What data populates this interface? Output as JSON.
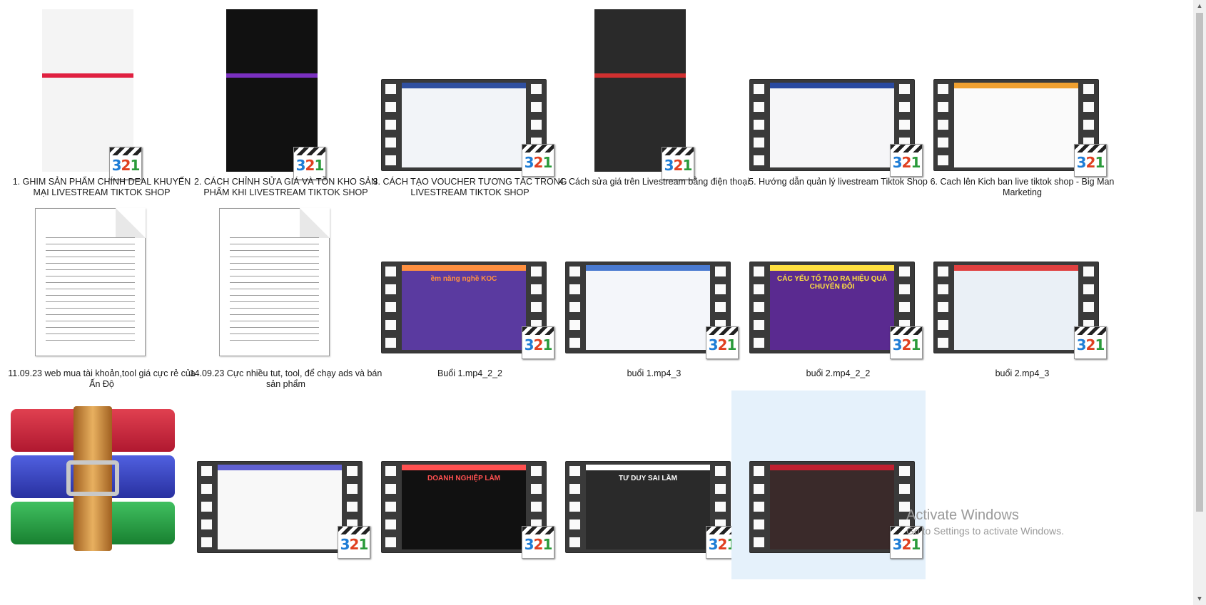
{
  "items": [
    {
      "kind": "video-portrait",
      "label": "1. GHIM SẢN PHẨM CHÍNH DEAL KHUYẾN MẠI LIVESTREAM TIKTOK SHOP",
      "screen": "#f4f4f4",
      "accent": "#e02040"
    },
    {
      "kind": "video-portrait",
      "label": "2. CÁCH CHỈNH SỬA GIÁ VÀ TỒN KHO SẢN PHẨM KHI LIVESTREAM TIKTOK SHOP",
      "screen": "#111111",
      "accent": "#7a30c0"
    },
    {
      "kind": "video",
      "label": "3. CÁCH TẠO VOUCHER TƯƠNG TÁC TRONG LIVESTREAM TIKTOK SHOP",
      "screen": "#f2f4f8",
      "accent": "#3050a0"
    },
    {
      "kind": "video-portrait",
      "label": "4. Cách sửa giá trên Livestream bằng điện thoại",
      "screen": "#2a2a2a",
      "accent": "#d03030"
    },
    {
      "kind": "video",
      "label": "5. Hướng dẫn quản lý livestream Tiktok Shop",
      "screen": "#f6f6f8",
      "accent": "#2a4aa0"
    },
    {
      "kind": "video",
      "label": "6. Cach lên Kich ban live tiktok shop - Big Man Marketing",
      "screen": "#fafafa",
      "accent": "#f0a030"
    },
    {
      "kind": "doc",
      "label": "11.09.23 web mua tài khoản,tool giá cực rẻ của Ấn Độ"
    },
    {
      "kind": "doc",
      "label": "14.09.23 Cực nhiều tut, tool, để chạy ads và bán sản phẩm"
    },
    {
      "kind": "video",
      "label": "Buổi 1.mp4_2_2",
      "screen": "#5a3aa0",
      "accent": "#ff9040",
      "caption": "ềm năng nghề KOC"
    },
    {
      "kind": "video",
      "label": "buổi 1.mp4_3",
      "screen": "#f4f6fa",
      "accent": "#4a7ad0"
    },
    {
      "kind": "video",
      "label": "buổi 2.mp4_2_2",
      "screen": "#5a2a90",
      "accent": "#ffe040",
      "caption": "CÁC YẾU TỐ TẠO RA HIỆU QUẢ CHUYỂN ĐỔI"
    },
    {
      "kind": "video",
      "label": "buổi 2.mp4_3",
      "screen": "#eaf0f6",
      "accent": "#e04040"
    },
    {
      "kind": "rar",
      "label": ""
    },
    {
      "kind": "video",
      "label": "",
      "screen": "#f8f8f8",
      "accent": "#6060d0"
    },
    {
      "kind": "video",
      "label": "",
      "screen": "#111111",
      "accent": "#ff5050",
      "caption": "DOANH NGHIỆP LÀM"
    },
    {
      "kind": "video",
      "label": "",
      "screen": "#2a2a2a",
      "accent": "#ffffff",
      "caption": "TƯ DUY SAI LẦM"
    },
    {
      "kind": "video",
      "label": "",
      "screen": "#3a2a2a",
      "accent": "#c02030",
      "selected": true
    }
  ],
  "watermark": {
    "line1": "Activate Windows",
    "line2": "Go to Settings to activate Windows."
  },
  "scrollbar": {
    "up": "▲",
    "down": "▼"
  }
}
